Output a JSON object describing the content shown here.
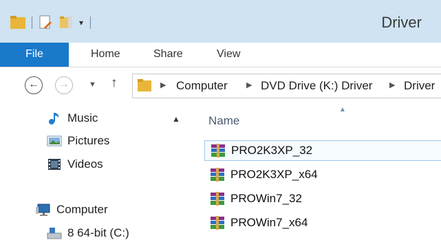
{
  "window": {
    "title": "Driver"
  },
  "ribbon": {
    "tabs": [
      "File",
      "Home",
      "Share",
      "View"
    ]
  },
  "address": {
    "crumbs": [
      "Computer",
      "DVD Drive (K:) Driver",
      "Driver"
    ]
  },
  "navpane": {
    "items": [
      {
        "label": "Music",
        "icon": "music-icon"
      },
      {
        "label": "Pictures",
        "icon": "pictures-icon"
      },
      {
        "label": "Videos",
        "icon": "videos-icon"
      },
      {
        "label": "Computer",
        "icon": "computer-icon"
      },
      {
        "label": "8 64-bit (C:)",
        "icon": "drive-icon"
      }
    ]
  },
  "filelist": {
    "column_name": "Name",
    "files": [
      "PRO2K3XP_32",
      "PRO2K3XP_x64",
      "PROWin7_32",
      "PROWin7_x64"
    ],
    "selected_index": 0
  },
  "colors": {
    "titlebar": "#cfe3f3",
    "file_tab": "#1979ca",
    "selection_border": "#9fc6ea"
  }
}
